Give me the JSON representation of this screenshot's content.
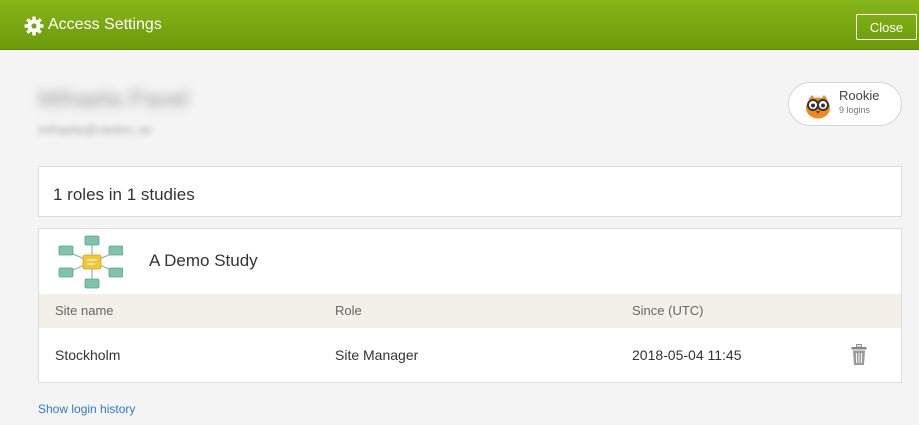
{
  "header": {
    "title": "Access Settings",
    "close_label": "Close",
    "bg_color": "#78a610"
  },
  "user": {
    "name": "Mihaela Pavel",
    "email": "mihaela@viedoc.se",
    "blurred": true
  },
  "rank": {
    "label": "Rookie",
    "logins": "9 logins",
    "icon": "owl-icon"
  },
  "summary": {
    "text": "1 roles in 1 studies"
  },
  "study": {
    "name": "A Demo Study",
    "icon": "study-network-icon",
    "columns": [
      "Site name",
      "Role",
      "Since (UTC)"
    ],
    "rows": [
      {
        "site": "Stockholm",
        "role": "Site Manager",
        "since": "2018-05-04 11:45"
      }
    ]
  },
  "footer": {
    "history_link": "Show login history"
  }
}
